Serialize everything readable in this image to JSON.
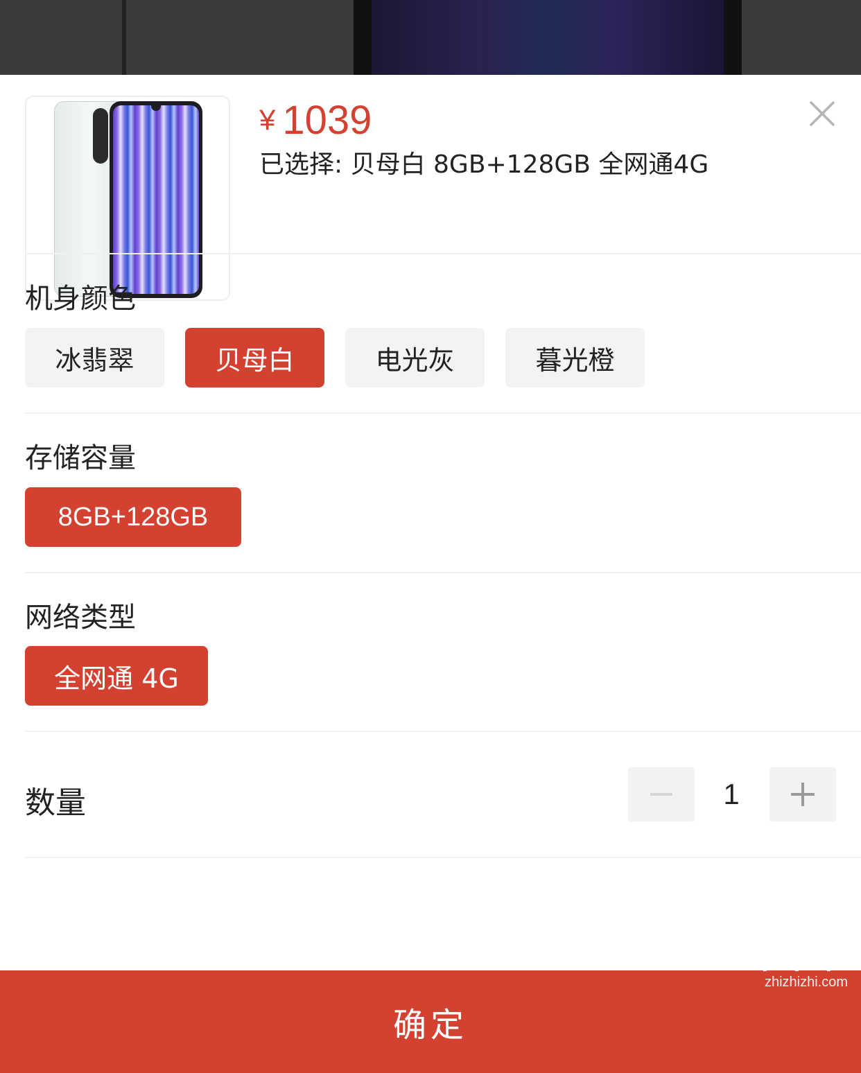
{
  "product": {
    "price_currency": "¥",
    "price_value": "1039",
    "selected_text": "已选择: 贝母白 8GB+128GB 全网通4G"
  },
  "sections": {
    "color": {
      "title": "机身颜色",
      "options": [
        "冰翡翠",
        "贝母白",
        "电光灰",
        "暮光橙"
      ],
      "selected": "贝母白"
    },
    "storage": {
      "title": "存储容量",
      "options": [
        "8GB+128GB"
      ],
      "selected": "8GB+128GB"
    },
    "network": {
      "title": "网络类型",
      "options": [
        "全网通 4G"
      ],
      "selected": "全网通 4G"
    }
  },
  "quantity": {
    "label": "数量",
    "value": "1"
  },
  "confirm_label": "确定",
  "watermark": {
    "brand": "值值值",
    "domain": "zhizhizhi.com"
  },
  "icons": [
    "close-icon",
    "minus-icon",
    "plus-icon"
  ],
  "colors": {
    "accent": "#d34130",
    "option_bg": "#f3f3f3"
  }
}
